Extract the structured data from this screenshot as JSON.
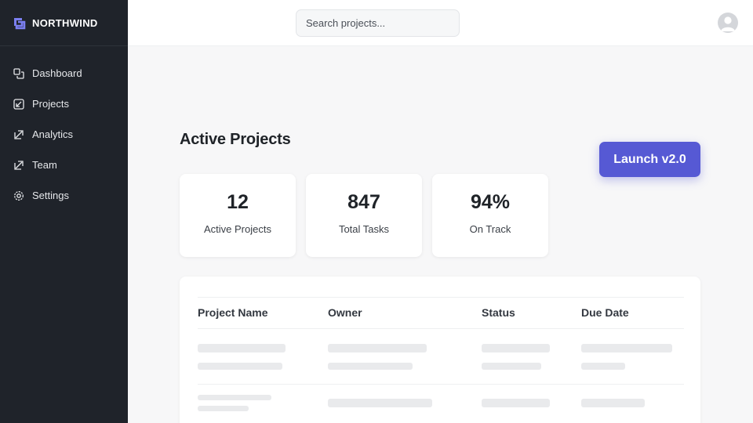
{
  "brand": {
    "name": "NORTHWIND",
    "logo_icon": "square-bracket-logo-icon",
    "accent": "#7b7ff0"
  },
  "sidebar": {
    "items": [
      {
        "label": "Dashboard",
        "icon": "layers-icon"
      },
      {
        "label": "Projects",
        "icon": "folder-icon"
      },
      {
        "label": "Analytics",
        "icon": "chart-icon"
      },
      {
        "label": "Team",
        "icon": "team-icon"
      },
      {
        "label": "Settings",
        "icon": "gear-icon"
      }
    ]
  },
  "header": {
    "search_placeholder": "Search projects..."
  },
  "main": {
    "title": "Active Projects",
    "launch_label": "Launch v2.0",
    "launch_color": "#5659d4",
    "stats": [
      {
        "value": "12",
        "label": "Active Projects"
      },
      {
        "value": "847",
        "label": "Total Tasks"
      },
      {
        "value": "94%",
        "label": "On Track"
      }
    ],
    "table": {
      "columns": [
        "Project Name",
        "Owner",
        "Status",
        "Due Date"
      ]
    }
  }
}
